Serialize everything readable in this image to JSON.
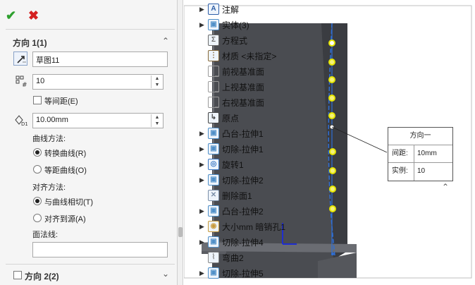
{
  "panel": {
    "ok_icon": "check-icon",
    "cancel_icon": "close-icon",
    "direction1": {
      "title": "方向 1(1)",
      "collapse_icon": "chevron-up-icon",
      "sketch_value": "草图11",
      "count_value": "10",
      "equal_spacing_label": "等间距(E)",
      "spacing_value": "10.00mm",
      "curve_method_label": "曲线方法:",
      "curve_options": [
        "转换曲线(R)",
        "等距曲线(O)"
      ],
      "curve_selected": 0,
      "align_method_label": "对齐方法:",
      "align_options": [
        "与曲线相切(T)",
        "对齐到源(A)"
      ],
      "align_selected": 0,
      "face_normal_label": "面法线:",
      "face_normal_value": ""
    },
    "direction2": {
      "title": "方向 2(2)",
      "collapse_icon": "chevron-down-icon"
    }
  },
  "tree": {
    "items": [
      {
        "label": "注解",
        "icon": "annotation-icon",
        "expandable": true,
        "color": "#2f5fa8"
      },
      {
        "label": "实体(3)",
        "icon": "solid-bodies-icon",
        "expandable": true,
        "color": "#4f8fc8"
      },
      {
        "label": "方程式",
        "icon": "equations-icon",
        "expandable": false,
        "color": "#6b6b6b"
      },
      {
        "label": "材质 <未指定>",
        "icon": "material-icon",
        "expandable": false,
        "color": "#8a6b3a"
      },
      {
        "label": "前视基准面",
        "icon": "plane-icon",
        "expandable": false,
        "color": "#9a9a9a"
      },
      {
        "label": "上视基准面",
        "icon": "plane-icon",
        "expandable": false,
        "color": "#9a9a9a"
      },
      {
        "label": "右视基准面",
        "icon": "plane-icon",
        "expandable": false,
        "color": "#9a9a9a"
      },
      {
        "label": "原点",
        "icon": "origin-icon",
        "expandable": false,
        "color": "#444444"
      },
      {
        "label": "凸台-拉伸1",
        "icon": "boss-extrude-icon",
        "expandable": true,
        "color": "#4f8fc8"
      },
      {
        "label": "切除-拉伸1",
        "icon": "cut-extrude-icon",
        "expandable": true,
        "color": "#4f8fc8"
      },
      {
        "label": "旋转1",
        "icon": "revolve-icon",
        "expandable": true,
        "color": "#3b78c4"
      },
      {
        "label": "切除-拉伸2",
        "icon": "cut-extrude-icon",
        "expandable": true,
        "color": "#4f8fc8"
      },
      {
        "label": "删除面1",
        "icon": "delete-face-icon",
        "expandable": false,
        "color": "#7b8fa8"
      },
      {
        "label": "凸台-拉伸2",
        "icon": "boss-extrude-icon",
        "expandable": true,
        "color": "#4f8fc8"
      },
      {
        "label": "大小mm 暗销孔1",
        "icon": "hole-wizard-icon",
        "expandable": true,
        "color": "#c89a3a"
      },
      {
        "label": "切除-拉伸4",
        "icon": "cut-extrude-icon",
        "expandable": true,
        "color": "#4f8fc8"
      },
      {
        "label": "弯曲2",
        "icon": "flex-icon",
        "expandable": false,
        "color": "#8a8a8a"
      },
      {
        "label": "切除-拉伸5",
        "icon": "cut-extrude-icon",
        "expandable": true,
        "color": "#4f8fc8"
      }
    ]
  },
  "callout": {
    "title": "方向一",
    "rows": [
      {
        "label": "间距:",
        "value": "10mm"
      },
      {
        "label": "实例:",
        "value": "10"
      }
    ],
    "collapse_icon": "chevron-up-icon"
  },
  "colors": {
    "accent": "#2f6fd6",
    "pattern_point": "#e6e600",
    "ok": "#2ea02e",
    "cancel": "#d42020"
  }
}
